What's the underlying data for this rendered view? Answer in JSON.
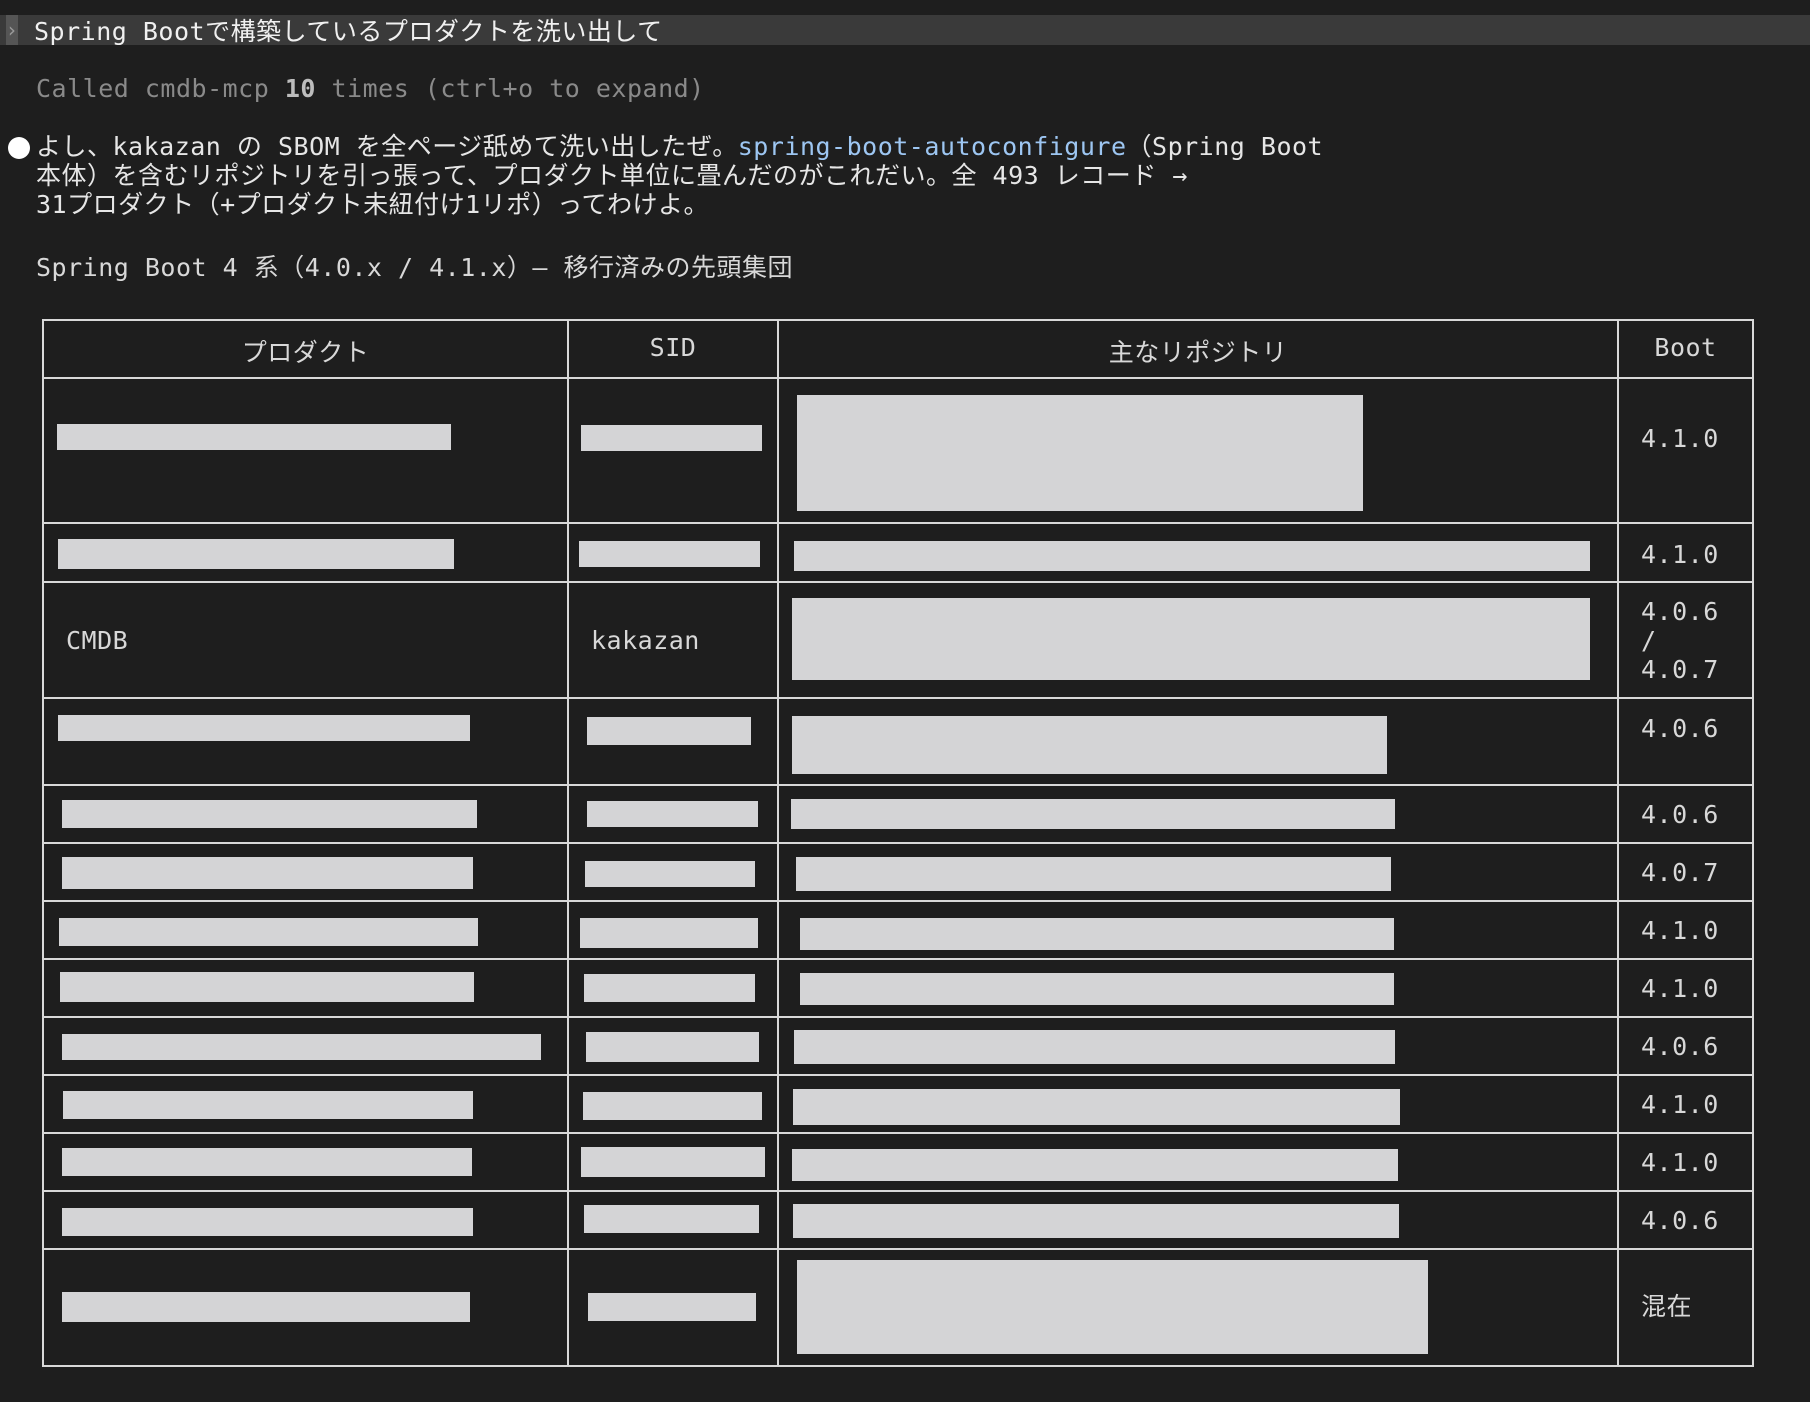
{
  "prompt": {
    "text": "Spring Bootで構築しているプロダクトを洗い出して"
  },
  "tool_call": {
    "prefix": "Called cmdb-mcp ",
    "count": "10",
    "suffix": " times (ctrl+o to expand)"
  },
  "response": {
    "line1_a": "よし、kakazan の SBOM を全ページ舐めて洗い出したぜ。",
    "line1_link": "spring-boot-autoconfigure",
    "line1_b": "（Spring Boot",
    "line2": "本体）を含むリポジトリを引っ張って、プロダクト単位に畳んだのがこれだい。全 493 レコード →",
    "line3": "31プロダクト（+プロダクト未紐付け1リポ）ってわけよ。"
  },
  "section_heading": "Spring Boot 4 系（4.0.x / 4.1.x）— 移行済みの先頭集団",
  "table": {
    "headers": {
      "product": "プロダクト",
      "sid": "SID",
      "repos": "主なリポジトリ",
      "boot": "Boot"
    },
    "rows": [
      {
        "product": "",
        "sid": "",
        "boot": "4.1.0"
      },
      {
        "product": "",
        "sid": "",
        "boot": "4.1.0"
      },
      {
        "product": "CMDB",
        "sid": "kakazan",
        "boot": "4.0.6\n/\n4.0.7"
      },
      {
        "product": "",
        "sid": "",
        "boot": "4.0.6"
      },
      {
        "product": "",
        "sid": "",
        "boot": "4.0.6"
      },
      {
        "product": "",
        "sid": "",
        "boot": "4.0.7"
      },
      {
        "product": "",
        "sid": "",
        "boot": "4.1.0"
      },
      {
        "product": "",
        "sid": "",
        "boot": "4.1.0"
      },
      {
        "product": "",
        "sid": "",
        "boot": "4.0.6"
      },
      {
        "product": "",
        "sid": "",
        "boot": "4.1.0"
      },
      {
        "product": "",
        "sid": "",
        "boot": "4.1.0"
      },
      {
        "product": "",
        "sid": "",
        "boot": "4.0.6"
      },
      {
        "product": "",
        "sid": "",
        "boot": "混在"
      }
    ]
  },
  "colors": {
    "background": "#1e1e1e",
    "prompt_bar": "#3a3a3a",
    "link": "#9dc6f2",
    "redaction": "#d4d4d6",
    "border": "#d8d8d8"
  }
}
